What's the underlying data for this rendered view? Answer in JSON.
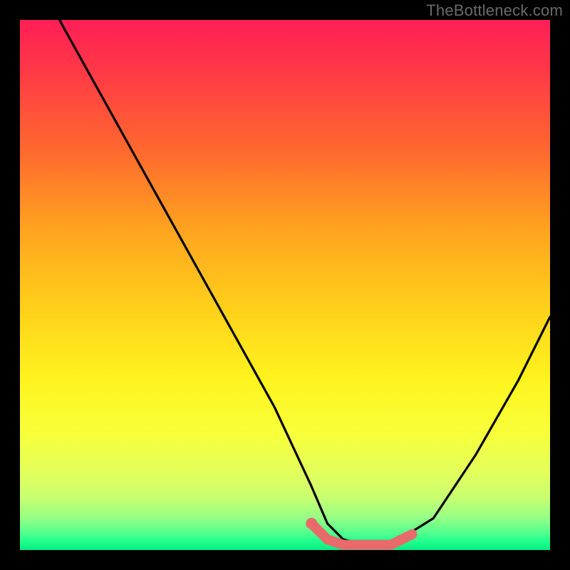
{
  "watermark": "TheBottleneck.com",
  "chart_data": {
    "type": "line",
    "title": "",
    "xlabel": "",
    "ylabel": "",
    "xlim": [
      0,
      100
    ],
    "ylim": [
      0,
      100
    ],
    "series": [
      {
        "name": "bottleneck-curve",
        "x": [
          0,
          8,
          18,
          28,
          38,
          48,
          55,
          58,
          61,
          65,
          70,
          78,
          86,
          94,
          100
        ],
        "values": [
          115,
          99,
          81,
          63,
          45,
          27,
          12,
          5,
          2,
          1,
          1,
          6,
          18,
          32,
          44
        ]
      }
    ],
    "highlight_segment": {
      "name": "salmon-band",
      "x": [
        55,
        58,
        61,
        65,
        70,
        74
      ],
      "values": [
        5,
        2,
        1,
        1,
        1,
        3
      ]
    },
    "marker": {
      "x": 55,
      "y": 5
    },
    "gradient_stops": [
      {
        "pos": 0,
        "color": "#ff1e56"
      },
      {
        "pos": 25,
        "color": "#ff6a2e"
      },
      {
        "pos": 55,
        "color": "#ffd21a"
      },
      {
        "pos": 85,
        "color": "#e4ff5a"
      },
      {
        "pos": 100,
        "color": "#0cea81"
      }
    ]
  }
}
